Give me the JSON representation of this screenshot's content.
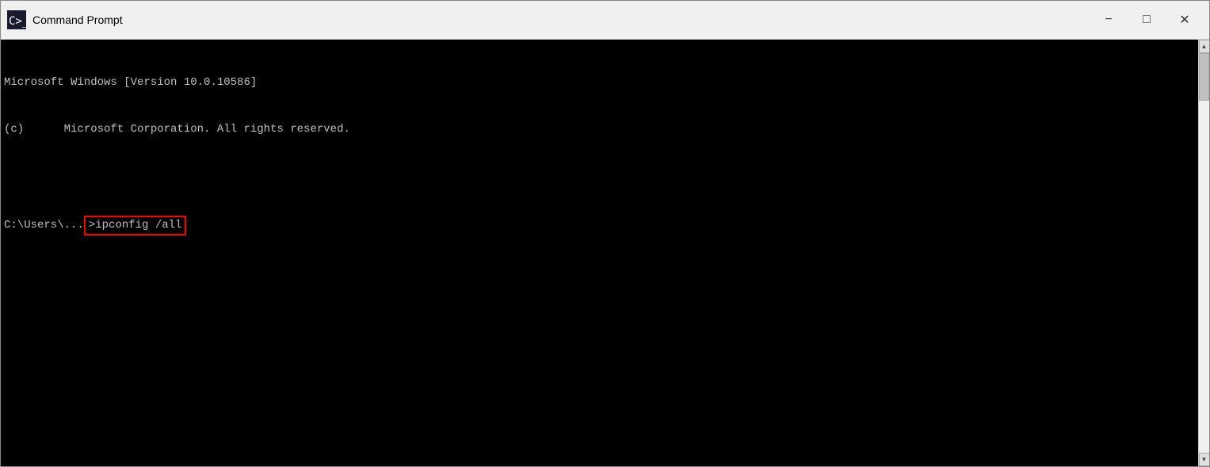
{
  "titleBar": {
    "title": "Command Prompt",
    "iconAlt": "cmd-icon",
    "minimizeLabel": "−",
    "maximizeLabel": "□",
    "closeLabel": "✕"
  },
  "terminal": {
    "line1": "Microsoft Windows [Version 10.0.10586]",
    "line2": "(c)      Microsoft Corporation. All rights reserved.",
    "emptyLine": "",
    "promptPrefix": "C:\\Users\\...",
    "commandHighlighted": ">ipconfig /all"
  }
}
